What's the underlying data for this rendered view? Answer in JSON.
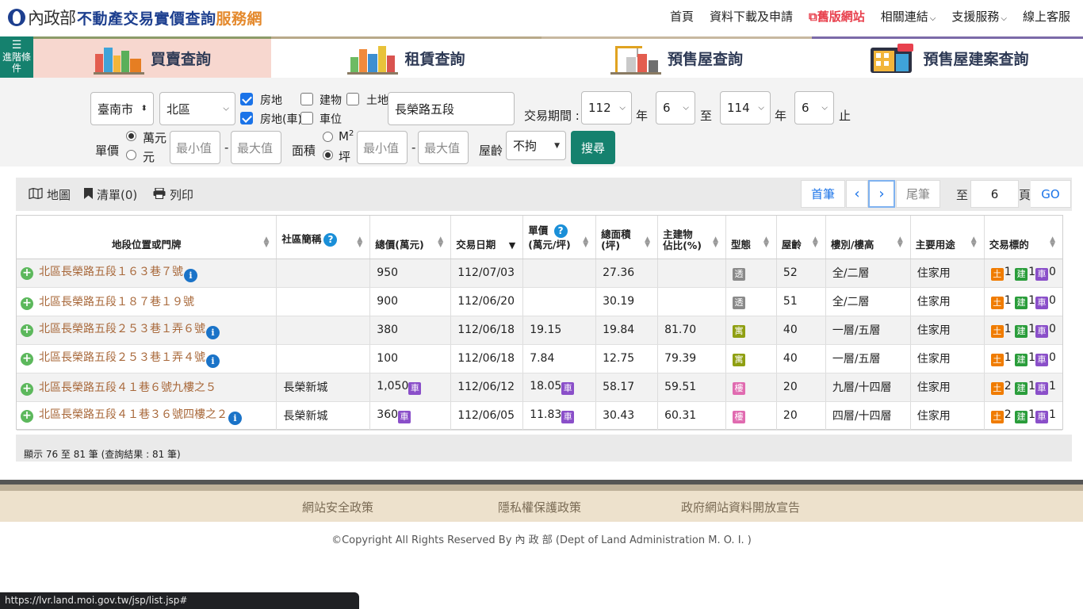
{
  "header": {
    "ministry": "內政部",
    "site_title": "不動產交易實價查詢",
    "site_title_accent": "服務網",
    "nav": [
      "首頁",
      "資料下載及申請",
      "舊版網站",
      "相關連結",
      "支援服務",
      "線上客服"
    ]
  },
  "side_toggle": "進階條件",
  "tabs": [
    {
      "label": "買賣查詢",
      "active": true
    },
    {
      "label": "租賃查詢",
      "active": false
    },
    {
      "label": "預售屋查詢",
      "active": false
    },
    {
      "label": "預售屋建案查詢",
      "active": false
    }
  ],
  "filter": {
    "city": "臺南市",
    "district": "北區",
    "types": {
      "land_building": "房地",
      "building": "建物",
      "land": "土地",
      "land_building_car": "房地(車)",
      "parking": "車位"
    },
    "road": "長榮路五段",
    "period_label": "交易期間 :",
    "from_year": "112",
    "from_month": "6",
    "to_year": "114",
    "to_month": "6",
    "year_unit": "年",
    "to_word": "至",
    "end_word": "止",
    "price_label": "單價",
    "price_units": [
      "萬元",
      "元"
    ],
    "area_label": "面積",
    "area_units": [
      "M",
      "坪"
    ],
    "area_sup": "2",
    "min_placeholder": "最小值",
    "max_placeholder": "最大值",
    "dash": "-",
    "age_label": "屋齡",
    "age_value": "不拘",
    "search_button": "搜尋"
  },
  "results_toolbar": {
    "map": "地圖",
    "list": "清單(0)",
    "print": "列印",
    "first": "首筆",
    "prev": "‹",
    "next": "›",
    "last": "尾筆",
    "to_label": "至",
    "page_value": "6",
    "page_unit": "頁",
    "go": "GO"
  },
  "table": {
    "headers": [
      "地段位置或門牌",
      "社區簡稱",
      "總價(萬元)",
      "交易日期",
      "單價",
      "(萬元/坪)",
      "總面積",
      "(坪)",
      "主建物",
      "佔比(%)",
      "型態",
      "屋齡",
      "樓別/樓高",
      "主要用途",
      "交易標的"
    ],
    "rows": [
      {
        "addr": "北區長榮路五段１６３巷７號",
        "info": true,
        "community": "",
        "total": "950",
        "total_car": false,
        "date": "112/07/03",
        "unit": "",
        "unit_car": false,
        "area": "27.36",
        "main_ratio": "",
        "type": "透",
        "type_color": "#8a8a8a",
        "age": "52",
        "floor": "全/二層",
        "usage": "住家用",
        "land": "1",
        "bldg": "1",
        "car": "0"
      },
      {
        "addr": "北區長榮路五段１８７巷１９號",
        "info": false,
        "community": "",
        "total": "900",
        "total_car": false,
        "date": "112/06/20",
        "unit": "",
        "unit_car": false,
        "area": "30.19",
        "main_ratio": "",
        "type": "透",
        "type_color": "#8a8a8a",
        "age": "51",
        "floor": "全/二層",
        "usage": "住家用",
        "land": "1",
        "bldg": "1",
        "car": "0"
      },
      {
        "addr": "北區長榮路五段２５３巷１弄６號",
        "info": true,
        "community": "",
        "total": "380",
        "total_car": false,
        "date": "112/06/18",
        "unit": "19.15",
        "unit_car": false,
        "area": "19.84",
        "main_ratio": "81.70",
        "type": "寓",
        "type_color": "#8f9f12",
        "age": "40",
        "floor": "一層/五層",
        "usage": "住家用",
        "land": "1",
        "bldg": "1",
        "car": "0"
      },
      {
        "addr": "北區長榮路五段２５３巷１弄４號",
        "info": true,
        "community": "",
        "total": "100",
        "total_car": false,
        "date": "112/06/18",
        "unit": "7.84",
        "unit_car": false,
        "area": "12.75",
        "main_ratio": "79.39",
        "type": "寓",
        "type_color": "#8f9f12",
        "age": "40",
        "floor": "一層/五層",
        "usage": "住家用",
        "land": "1",
        "bldg": "1",
        "car": "0"
      },
      {
        "addr": "北區長榮路五段４１巷６號九樓之５",
        "info": false,
        "community": "長榮新城",
        "total": "1,050",
        "total_car": true,
        "date": "112/06/12",
        "unit": "18.05",
        "unit_car": true,
        "area": "58.17",
        "main_ratio": "59.51",
        "type": "樓",
        "type_color": "#e06bb0",
        "age": "20",
        "floor": "九層/十四層",
        "usage": "住家用",
        "land": "2",
        "bldg": "1",
        "car": "1"
      },
      {
        "addr": "北區長榮路五段４１巷３６號四樓之２",
        "info": true,
        "community": "長榮新城",
        "total": "360",
        "total_car": true,
        "date": "112/06/05",
        "unit": "11.83",
        "unit_car": true,
        "area": "30.43",
        "main_ratio": "60.31",
        "type": "樓",
        "type_color": "#e06bb0",
        "age": "20",
        "floor": "四層/十四層",
        "usage": "住家用",
        "land": "2",
        "bldg": "1",
        "car": "1"
      }
    ],
    "car_badge": "車",
    "land_badge": "土",
    "bldg_badge": "建",
    "info_badge": "i",
    "help_badge": "?"
  },
  "summary": "顯示 76 至 81 筆 (查詢結果 : 81 筆)",
  "footer": {
    "links": [
      "網站安全政策",
      "隱私權保護政策",
      "政府網站資料開放宣告"
    ],
    "copyright": "©Copyright All Rights Reserved By 內 政 部 (Dept of Land Administration M. O. I. )"
  },
  "status_url": "https://lvr.land.moi.gov.tw/jsp/list.jsp#",
  "colors": {
    "accent": "#15816e",
    "link": "#1a73e8",
    "address": "#a8683a",
    "land": "#f07c00",
    "building": "#2a9d3b",
    "car": "#8a4fc9"
  }
}
